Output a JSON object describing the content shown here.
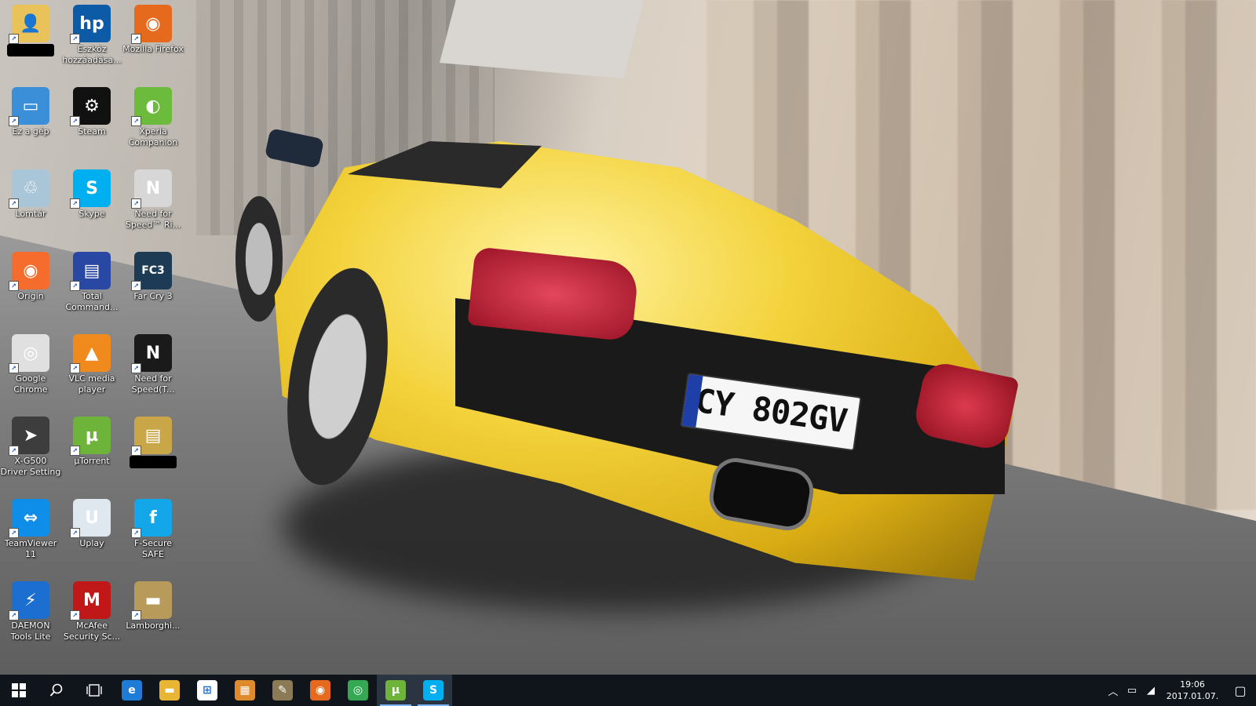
{
  "desktop": {
    "icons": [
      {
        "label": "",
        "redacted": true,
        "icon": "user-folder-icon",
        "col": 0,
        "row": 0
      },
      {
        "label": "Eszköz hozzáadása...",
        "icon": "hp-icon",
        "col": 1,
        "row": 0
      },
      {
        "label": "Mozilla Firefox",
        "icon": "firefox-icon",
        "col": 2,
        "row": 0
      },
      {
        "label": "Ez a gép",
        "icon": "this-pc-icon",
        "col": 0,
        "row": 1
      },
      {
        "label": "Steam",
        "icon": "steam-icon",
        "col": 1,
        "row": 1
      },
      {
        "label": "Xperia Companion",
        "icon": "xperia-companion-icon",
        "col": 2,
        "row": 1
      },
      {
        "label": "Lomtár",
        "icon": "recycle-bin-icon",
        "col": 0,
        "row": 2
      },
      {
        "label": "Skype",
        "icon": "skype-icon",
        "col": 1,
        "row": 2
      },
      {
        "label": "Need for Speed™ Ri...",
        "icon": "nfs-rivals-icon",
        "col": 2,
        "row": 2
      },
      {
        "label": "Origin",
        "icon": "origin-icon",
        "col": 0,
        "row": 3
      },
      {
        "label": "Total Command...",
        "icon": "total-commander-icon",
        "col": 1,
        "row": 3
      },
      {
        "label": "Far Cry 3",
        "icon": "far-cry-3-icon",
        "col": 2,
        "row": 3
      },
      {
        "label": "Google Chrome",
        "icon": "chrome-icon",
        "col": 0,
        "row": 4
      },
      {
        "label": "VLC media player",
        "icon": "vlc-icon",
        "col": 1,
        "row": 4
      },
      {
        "label": "Need for Speed(T...",
        "icon": "nfs-the-run-icon",
        "col": 2,
        "row": 4
      },
      {
        "label": "X-G500 Driver Setting",
        "icon": "xg500-driver-icon",
        "col": 0,
        "row": 5
      },
      {
        "label": "µTorrent",
        "icon": "utorrent-icon",
        "col": 1,
        "row": 5
      },
      {
        "label": "",
        "redacted": true,
        "icon": "game-folder-icon",
        "col": 2,
        "row": 5
      },
      {
        "label": "TeamViewer 11",
        "icon": "teamviewer-icon",
        "col": 0,
        "row": 6
      },
      {
        "label": "Uplay",
        "icon": "uplay-icon",
        "col": 1,
        "row": 6
      },
      {
        "label": "F-Secure SAFE",
        "icon": "fsecure-icon",
        "col": 2,
        "row": 6
      },
      {
        "label": "DAEMON Tools Lite",
        "icon": "daemon-tools-icon",
        "col": 0,
        "row": 7
      },
      {
        "label": "McAfee Security Sc...",
        "icon": "mcafee-icon",
        "col": 1,
        "row": 7
      },
      {
        "label": "Lamborghi...",
        "icon": "lamborghini-image-icon",
        "col": 2,
        "row": 7
      }
    ],
    "wallpaper_plate": "CY 802GV"
  },
  "taskbar": {
    "apps": [
      {
        "name": "edge-icon",
        "glyph": "e",
        "color": "#1e7bd6",
        "active": false
      },
      {
        "name": "file-explorer-icon",
        "glyph": "▬",
        "color": "#e8b634",
        "active": false
      },
      {
        "name": "store-icon",
        "glyph": "⊞",
        "color": "#ffffff",
        "active": false
      },
      {
        "name": "paint-app-icon",
        "glyph": "▦",
        "color": "#e08a2e",
        "active": false
      },
      {
        "name": "game-app-icon",
        "glyph": "✎",
        "color": "#8a7a55",
        "active": false
      },
      {
        "name": "firefox-icon",
        "glyph": "◉",
        "color": "#e66a1e",
        "active": false
      },
      {
        "name": "chrome-icon",
        "glyph": "◎",
        "color": "#34a853",
        "active": false
      },
      {
        "name": "utorrent-icon",
        "glyph": "µ",
        "color": "#6fb43a",
        "active": true
      },
      {
        "name": "skype-icon",
        "glyph": "S",
        "color": "#00aff0",
        "active": true
      }
    ],
    "clock": {
      "time": "19:06",
      "date": "2017.01.07."
    }
  }
}
